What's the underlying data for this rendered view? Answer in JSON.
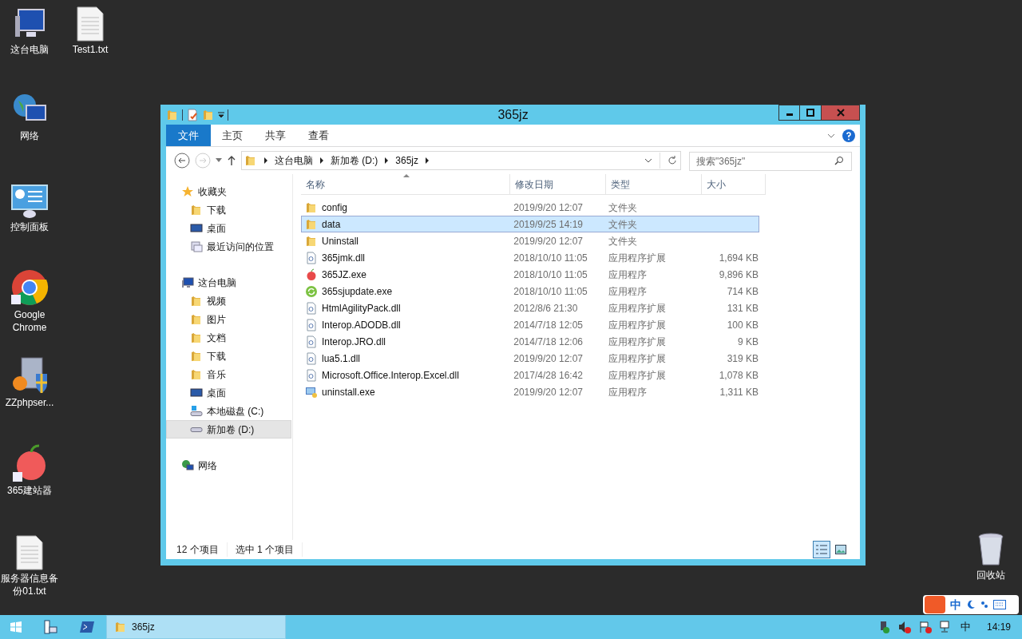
{
  "desktop_icons": [
    {
      "label": "这台电脑",
      "kind": "computer"
    },
    {
      "label": "Test1.txt",
      "kind": "text"
    },
    {
      "label": "网络",
      "kind": "network"
    },
    {
      "label": "控制面板",
      "kind": "control_panel"
    },
    {
      "label": "Google Chrome",
      "kind": "chrome"
    },
    {
      "label": "ZZphpser...",
      "kind": "server"
    },
    {
      "label": "365建站器",
      "kind": "apple"
    },
    {
      "label": "服务器信息备份01.txt",
      "kind": "text"
    },
    {
      "label": "回收站",
      "kind": "recycle"
    }
  ],
  "window": {
    "title": "365jz",
    "ribbon_tabs": [
      {
        "label": "文件",
        "kind": "file_menu",
        "selected": false
      },
      {
        "label": "主页",
        "kind": "tab",
        "selected": false
      },
      {
        "label": "共享",
        "kind": "tab",
        "selected": false
      },
      {
        "label": "查看",
        "kind": "tab",
        "selected": false
      }
    ],
    "address": {
      "breadcrumbs": [
        "这台电脑",
        "新加卷 (D:)",
        "365jz"
      ]
    },
    "search": {
      "placeholder": "搜索\"365jz\""
    },
    "nav_pane": [
      {
        "label": "收藏夹",
        "kind": "star",
        "children": [
          {
            "label": "下载",
            "kind": "download",
            "selected": false
          },
          {
            "label": "桌面",
            "kind": "desktop",
            "selected": false
          },
          {
            "label": "最近访问的位置",
            "kind": "recent",
            "selected": false
          }
        ]
      },
      {
        "label": "这台电脑",
        "kind": "computer",
        "children": [
          {
            "label": "视频",
            "kind": "video",
            "selected": false
          },
          {
            "label": "图片",
            "kind": "picture",
            "selected": false
          },
          {
            "label": "文档",
            "kind": "document",
            "selected": false
          },
          {
            "label": "下载",
            "kind": "download",
            "selected": false
          },
          {
            "label": "音乐",
            "kind": "music",
            "selected": false
          },
          {
            "label": "桌面",
            "kind": "desktop",
            "selected": false
          },
          {
            "label": "本地磁盘 (C:)",
            "kind": "drive_c",
            "selected": false
          },
          {
            "label": "新加卷 (D:)",
            "kind": "drive",
            "selected": true
          }
        ]
      },
      {
        "label": "网络",
        "kind": "network"
      }
    ],
    "columns": [
      "名称",
      "修改日期",
      "类型",
      "大小"
    ],
    "rows": [
      {
        "name": "config",
        "date": "2019/9/20 12:07",
        "type": "文件夹",
        "kind": "folder",
        "selected": false
      },
      {
        "name": "data",
        "date": "2019/9/25 14:19",
        "type": "文件夹",
        "kind": "folder",
        "selected": true
      },
      {
        "name": "Uninstall",
        "date": "2019/9/20 12:07",
        "type": "文件夹",
        "kind": "folder",
        "selected": false
      },
      {
        "name": "365jmk.dll",
        "date": "2018/10/10 11:05",
        "type": "应用程序扩展",
        "size": "1,694 KB",
        "kind": "dll",
        "selected": false
      },
      {
        "name": "365JZ.exe",
        "date": "2018/10/10 11:05",
        "type": "应用程序",
        "size": "9,896 KB",
        "kind": "apple",
        "selected": false
      },
      {
        "name": "365sjupdate.exe",
        "date": "2018/10/10 11:05",
        "type": "应用程序",
        "size": "714 KB",
        "kind": "update",
        "selected": false
      },
      {
        "name": "HtmlAgilityPack.dll",
        "date": "2012/8/6 21:30",
        "type": "应用程序扩展",
        "size": "131 KB",
        "kind": "dll",
        "selected": false
      },
      {
        "name": "Interop.ADODB.dll",
        "date": "2014/7/18 12:05",
        "type": "应用程序扩展",
        "size": "100 KB",
        "kind": "dll",
        "selected": false
      },
      {
        "name": "Interop.JRO.dll",
        "date": "2014/7/18 12:06",
        "type": "应用程序扩展",
        "size": "9 KB",
        "kind": "dll",
        "selected": false
      },
      {
        "name": "lua5.1.dll",
        "date": "2019/9/20 12:07",
        "type": "应用程序扩展",
        "size": "319 KB",
        "kind": "dll",
        "selected": false
      },
      {
        "name": "Microsoft.Office.Interop.Excel.dll",
        "date": "2017/4/28 16:42",
        "type": "应用程序扩展",
        "size": "1,078 KB",
        "kind": "dll",
        "selected": false
      },
      {
        "name": "uninstall.exe",
        "date": "2019/9/20 12:07",
        "type": "应用程序",
        "size": "1,311 KB",
        "kind": "setup",
        "selected": false
      }
    ],
    "status_bar": {
      "items": "12 个项目",
      "selection": "选中 1 个项目"
    },
    "views": [
      {
        "kind": "details",
        "selected": true
      },
      {
        "kind": "thumbnails",
        "selected": false
      }
    ]
  },
  "ime_bar": {
    "mode": "中"
  },
  "taskbar": {
    "windows": [
      {
        "label": "365jz",
        "selected": true
      }
    ],
    "ime": "中",
    "clock": "14:19"
  }
}
